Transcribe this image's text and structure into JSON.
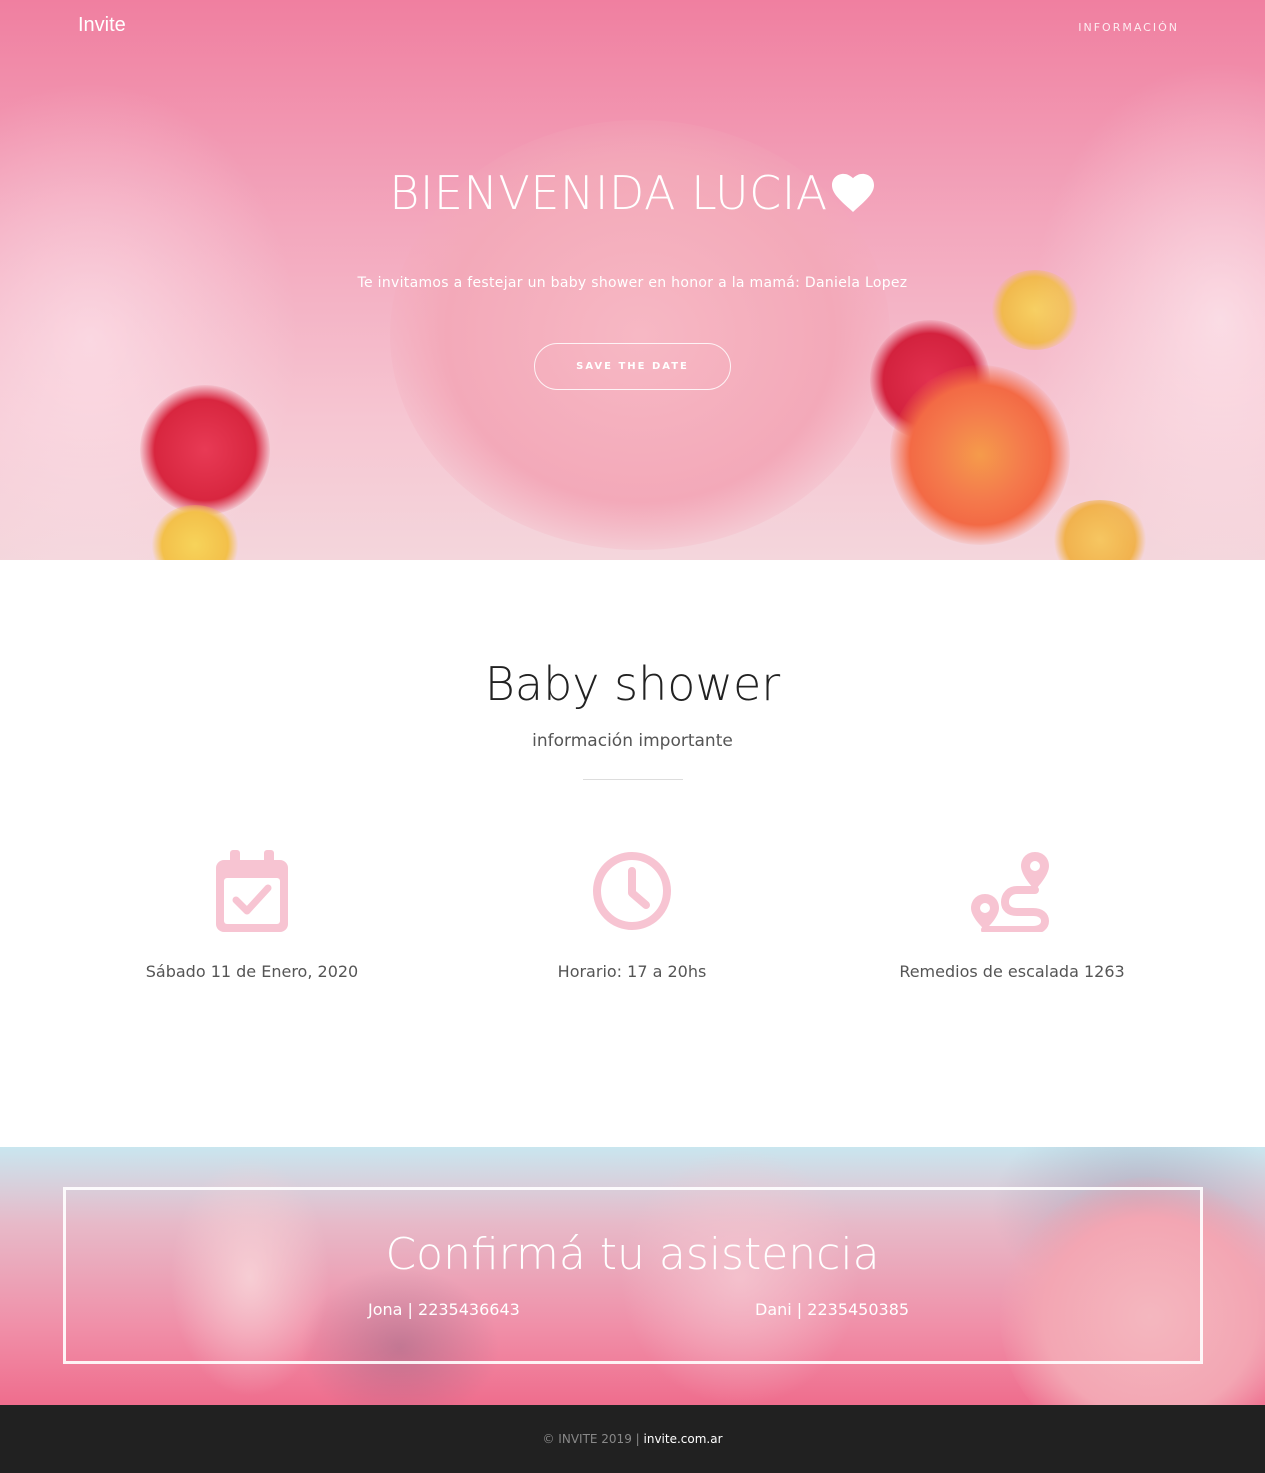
{
  "nav": {
    "brand": "Invite",
    "link": "INFORMACIÓN"
  },
  "hero": {
    "title": "BIENVENIDA LUCIA",
    "subtitle": "Te invitamos a festejar un baby shower en honor a la mamá: Daniela Lopez",
    "button": "SAVE THE DATE"
  },
  "info": {
    "title": "Baby shower",
    "subtitle": "información importante",
    "items": [
      {
        "icon": "calendar-check-icon",
        "label": "Sábado 11 de Enero, 2020"
      },
      {
        "icon": "clock-icon",
        "label": "Horario: 17 a 20hs"
      },
      {
        "icon": "route-icon",
        "label": "Remedios de escalada 1263"
      }
    ]
  },
  "rsvp": {
    "title": "Confirmá tu asistencia",
    "contacts": [
      "Jona | 2235436643",
      "Dani | 2235450385"
    ]
  },
  "footer": {
    "copyright": "© INVITE 2019 | ",
    "link": "invite.com.ar"
  },
  "colors": {
    "icon_pink": "#f7c4d2",
    "footer_bg": "#212121"
  }
}
